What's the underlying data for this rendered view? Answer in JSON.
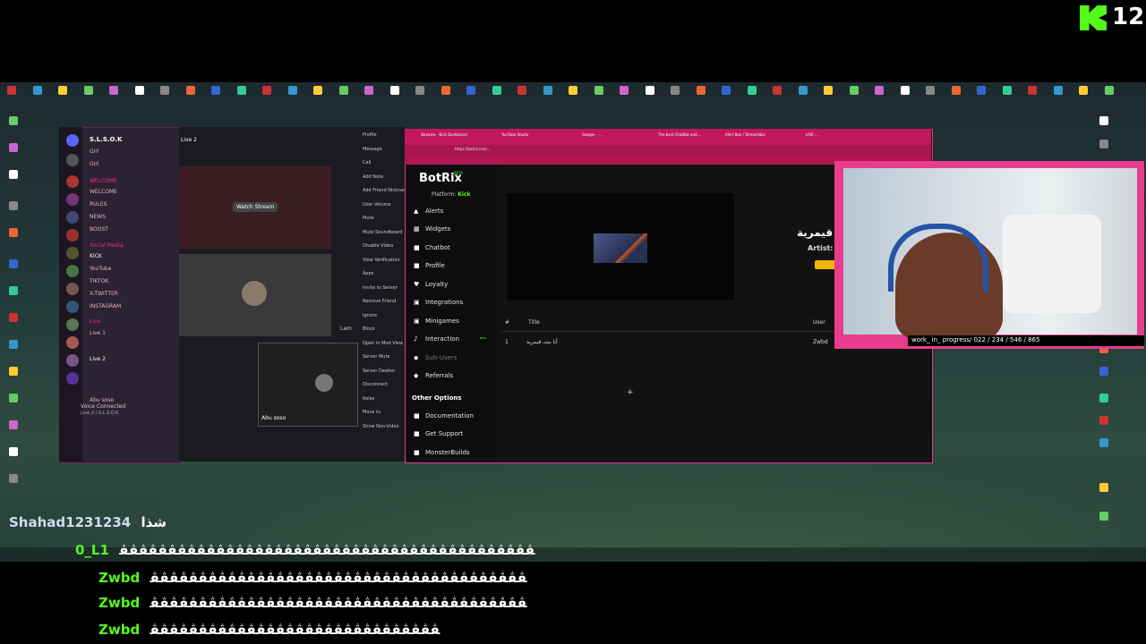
{
  "stream": {
    "viewer_count": "12"
  },
  "chat": [
    {
      "user": "Shahad1231234",
      "message": "شذا"
    },
    {
      "user": "0_L1",
      "message": "ﭭﭭﭭﭭﭭﭭﭭﭭﭭﭭﭭﭭﭭﭭﭭﭭﭭﭭﭭﭭﭭﭭﭭﭭﭭﭭﭭﭭﭭﭭﭭﭭﭭﭭﭭﭭﭭﭭﭭﭭﭭﭭﭭ"
    },
    {
      "user": "Zwbd",
      "message": "ﭭﭭﭭﭭﭭﭭﭭﭭﭭﭭﭭﭭﭭﭭﭭﭭﭭﭭﭭﭭﭭﭭﭭﭭﭭﭭﭭﭭﭭﭭﭭﭭﭭﭭﭭﭭﭭﭭﭭ"
    },
    {
      "user": "Zwbd",
      "message": "ﭭﭭﭭﭭﭭﭭﭭﭭﭭﭭﭭﭭﭭﭭﭭﭭﭭﭭﭭﭭﭭﭭﭭﭭﭭﭭﭭﭭﭭﭭﭭﭭﭭﭭﭭﭭﭭﭭﭭ"
    },
    {
      "user": "Zwbd",
      "message": "ﭭﭭﭭﭭﭭﭭﭭﭭﭭﭭﭭﭭﭭﭭﭭﭭﭭﭭﭭﭭﭭﭭﭭﭭﭭﭭﭭﭭﭭﭭ"
    }
  ],
  "discord": {
    "server_name": "S.L.S.O.K",
    "channel_header": "Live 2",
    "channels": [
      "Girl",
      "Girl",
      "WELCOME",
      "WELCOME",
      "RULES",
      "NEWS",
      "BOOST",
      "Social Media",
      "KICK",
      "YouTube",
      "TIKTOK",
      "X-TWITTER",
      "INSTAGRAM",
      "Live",
      "Live 1",
      "Live 2",
      "Abu soso"
    ],
    "voice_status": "Voice Connected",
    "voice_sub": "Live 2 / S.L.S.O.K",
    "watch_stream": "Watch Stream",
    "participant": "Abu soso",
    "participant2": "Lam",
    "context_menu": [
      "Profile",
      "Message",
      "Call",
      "Add Note",
      "Add Friend Nickname",
      "User Volume",
      "Mute",
      "Mute Soundboard",
      "Disable Video",
      "View Verification",
      "Apps",
      "Invite to Server",
      "Remove Friend",
      "Ignore",
      "Block",
      "Open in Mod View",
      "Server Mute",
      "Server Deafen",
      "Disconnect",
      "Roles",
      "Move to",
      "Show Non-Video"
    ]
  },
  "browser": {
    "tabs": [
      "Streams - Kick Dashboard",
      "YouTube Studio",
      "Google - ...",
      "The best ChatBot and ...",
      "Alert Box / Streamlabs",
      "LIVE ..."
    ],
    "url": "https://botrix.live/..."
  },
  "botrix": {
    "logo": "BotRix",
    "beta": "BETA",
    "platform_label": "Platform:",
    "platform_value": "Kick",
    "menu": [
      "Alerts",
      "Widgets",
      "Chatbot",
      "Profile",
      "Loyalty",
      "Integrations",
      "Minigames",
      "Interaction",
      "Sub-Users",
      "Referrals"
    ],
    "menu_icons": [
      "▲",
      "▦",
      "■",
      "■",
      "♥",
      "▣",
      "▣",
      "♪",
      "◆",
      "◆"
    ],
    "other_options_label": "Other Options",
    "other_options": [
      "Documentation",
      "Get Support",
      "MonsterBuilds"
    ],
    "now_playing_title": "أنا بنت قيمرية",
    "now_playing_artist": "Artist: s",
    "table_headers": {
      "num": "#",
      "title": "Title",
      "user": "User"
    },
    "rows": [
      {
        "num": "1",
        "title": "أنا بنت قيمرية",
        "user": "Zwbd"
      }
    ],
    "new_badge": "NEW"
  },
  "webcam": {
    "overlay_text": "work_ in_ progress/ 022 / 234 / 546 / 865"
  },
  "colors": {
    "accent_pink": "#e83d8d",
    "kick_green": "#53fc18",
    "discord_bg": "#2b2233"
  }
}
